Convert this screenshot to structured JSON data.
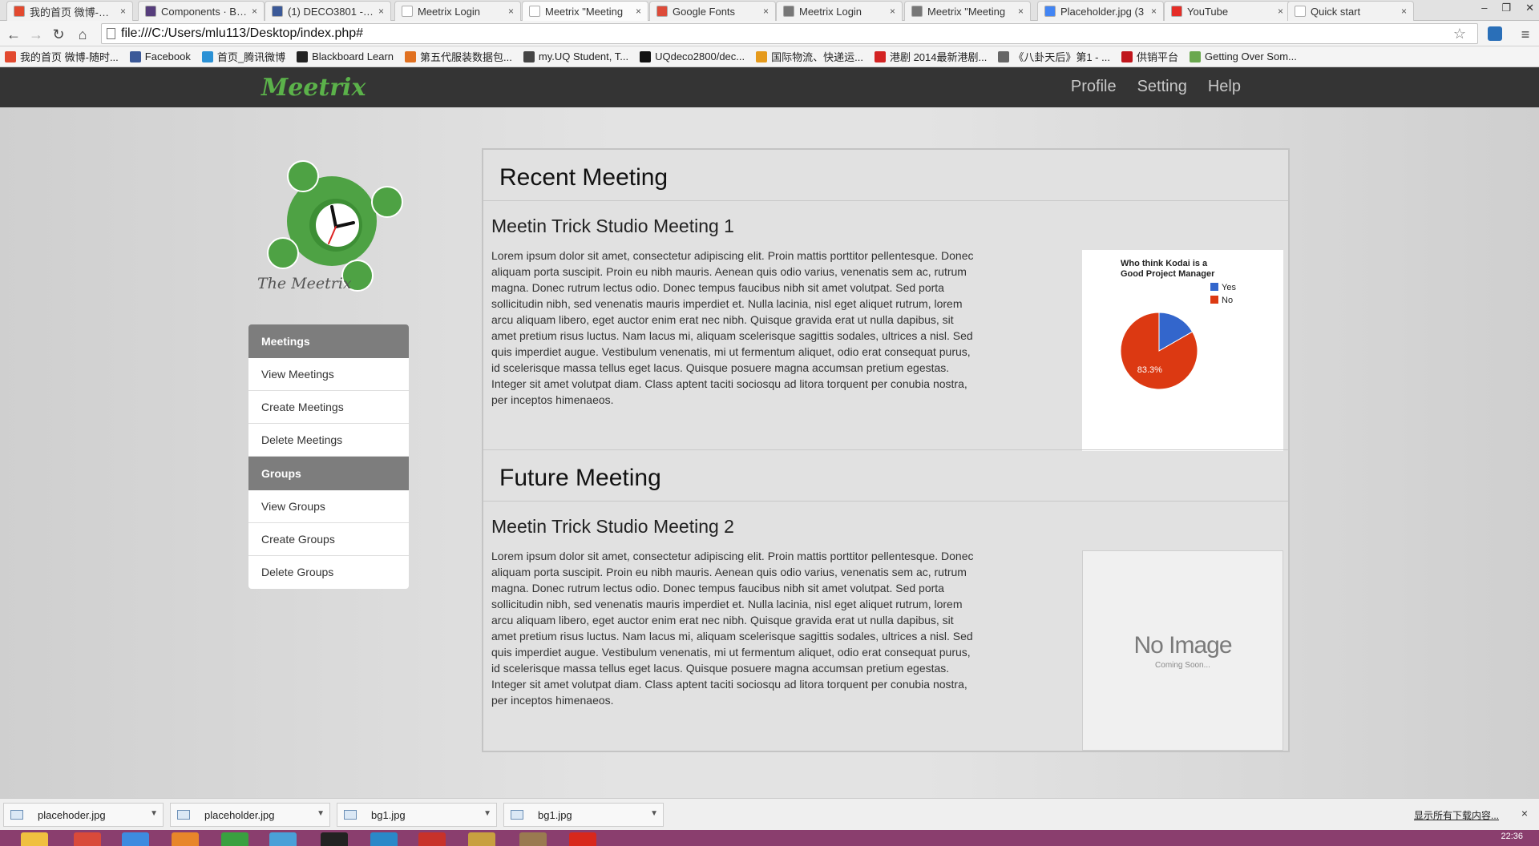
{
  "browser": {
    "tabs": [
      {
        "title": "我的首页 微博-随时",
        "color": "#e2492f"
      },
      {
        "title": "Components · Boo",
        "color": "#563d7c"
      },
      {
        "title": "(1) DECO3801 - M",
        "color": "#3b5998"
      },
      {
        "title": "Meetrix Login",
        "color": "#ffffff"
      },
      {
        "title": "Meetrix \"Meeting",
        "color": "#ffffff"
      },
      {
        "title": "Google Fonts",
        "color": "#dd4b39"
      },
      {
        "title": "Meetrix Login",
        "color": "#777777"
      },
      {
        "title": "Meetrix \"Meeting",
        "color": "#777777"
      },
      {
        "title": "Placeholder.jpg (3",
        "color": "#4285f4"
      },
      {
        "title": "YouTube",
        "color": "#e52d27"
      },
      {
        "title": "Quick start",
        "color": "#ffffff"
      }
    ],
    "address": "file:///C:/Users/mlu113/Desktop/index.php#",
    "bookmarks": [
      {
        "label": "我的首页 微博-随时...",
        "color": "#e2492f"
      },
      {
        "label": "Facebook",
        "color": "#3b5998"
      },
      {
        "label": "首页_腾讯微博",
        "color": "#2b91d5"
      },
      {
        "label": "Blackboard Learn",
        "color": "#222222"
      },
      {
        "label": "第五代服装数据包...",
        "color": "#e07020"
      },
      {
        "label": "my.UQ Student, T...",
        "color": "#444444"
      },
      {
        "label": "UQdeco2800/dec...",
        "color": "#111111"
      },
      {
        "label": "国际物流、快递运...",
        "color": "#e59a1c"
      },
      {
        "label": "港剧 2014最新港剧...",
        "color": "#d32323"
      },
      {
        "label": "《八卦天后》第1 - ...",
        "color": "#666666"
      },
      {
        "label": "供销平台",
        "color": "#c0161c"
      },
      {
        "label": "Getting Over Som...",
        "color": "#6aa84f"
      }
    ]
  },
  "site": {
    "brand": "Meetrix",
    "nav": {
      "profile": "Profile",
      "setting": "Setting",
      "help": "Help"
    },
    "logo_caption": "The Meetrix",
    "menu": {
      "meetings_head": "Meetings",
      "view_meetings": "View Meetings",
      "create_meetings": "Create Meetings",
      "delete_meetings": "Delete Meetings",
      "groups_head": "Groups",
      "view_groups": "View Groups",
      "create_groups": "Create Groups",
      "delete_groups": "Delete Groups"
    },
    "recent": {
      "heading": "Recent Meeting",
      "title": "Meetin Trick Studio Meeting 1",
      "body": "Lorem ipsum dolor sit amet, consectetur adipiscing elit. Proin mattis porttitor pellentesque. Donec aliquam porta suscipit. Proin eu nibh mauris. Aenean quis odio varius, venenatis sem ac, rutrum magna. Donec rutrum lectus odio. Donec tempus faucibus nibh sit amet volutpat. Sed porta sollicitudin nibh, sed venenatis mauris imperdiet et. Nulla lacinia, nisl eget aliquet rutrum, lorem arcu aliquam libero, eget auctor enim erat nec nibh. Quisque gravida erat ut nulla dapibus, sit amet pretium risus luctus. Nam lacus mi, aliquam scelerisque sagittis sodales, ultrices a nisl. Sed quis imperdiet augue. Vestibulum venenatis, mi ut fermentum aliquet, odio erat consequat purus, id scelerisque massa tellus eget lacus. Quisque posuere magna accumsan pretium egestas. Integer sit amet volutpat diam. Class aptent taciti sociosqu ad litora torquent per conubia nostra, per inceptos himenaeos."
    },
    "future": {
      "heading": "Future Meeting",
      "title": "Meetin Trick Studio Meeting 2",
      "body": "Lorem ipsum dolor sit amet, consectetur adipiscing elit. Proin mattis porttitor pellentesque. Donec aliquam porta suscipit. Proin eu nibh mauris. Aenean quis odio varius, venenatis sem ac, rutrum magna. Donec rutrum lectus odio. Donec tempus faucibus nibh sit amet volutpat. Sed porta sollicitudin nibh, sed venenatis mauris imperdiet et. Nulla lacinia, nisl eget aliquet rutrum, lorem arcu aliquam libero, eget auctor enim erat nec nibh. Quisque gravida erat ut nulla dapibus, sit amet pretium risus luctus. Nam lacus mi, aliquam scelerisque sagittis sodales, ultrices a nisl. Sed quis imperdiet augue. Vestibulum venenatis, mi ut fermentum aliquet, odio erat consequat purus, id scelerisque massa tellus eget lacus. Quisque posuere magna accumsan pretium egestas. Integer sit amet volutpat diam. Class aptent taciti sociosqu ad litora torquent per conubia nostra, per inceptos himenaeos.",
      "placeholder_main": "No Image",
      "placeholder_sub": "Coming Soon..."
    }
  },
  "chart_data": {
    "type": "pie",
    "title": "Who think Kodai is a Good Project Manager",
    "series": [
      {
        "name": "Yes",
        "value": 16.7,
        "color": "#3366cc"
      },
      {
        "name": "No",
        "value": 83.3,
        "color": "#dc3912"
      }
    ],
    "slice_labels": [
      "",
      "83.3%"
    ],
    "legend": "right"
  },
  "downloads": {
    "items": [
      "placehoder.jpg",
      "placeholder.jpg",
      "bg1.jpg",
      "bg1.jpg"
    ],
    "show_all": "显示所有下载内容...",
    "close": "×"
  },
  "taskbar": {
    "clock": "22:36",
    "icons": [
      "#f0c040",
      "#d94a3a",
      "#3d8be0",
      "#e8862a",
      "#3aa040",
      "#4aa0d8",
      "#222222",
      "#2a88c8",
      "#c8322a",
      "#c8a040",
      "#9a7a50",
      "#d8281c"
    ]
  }
}
